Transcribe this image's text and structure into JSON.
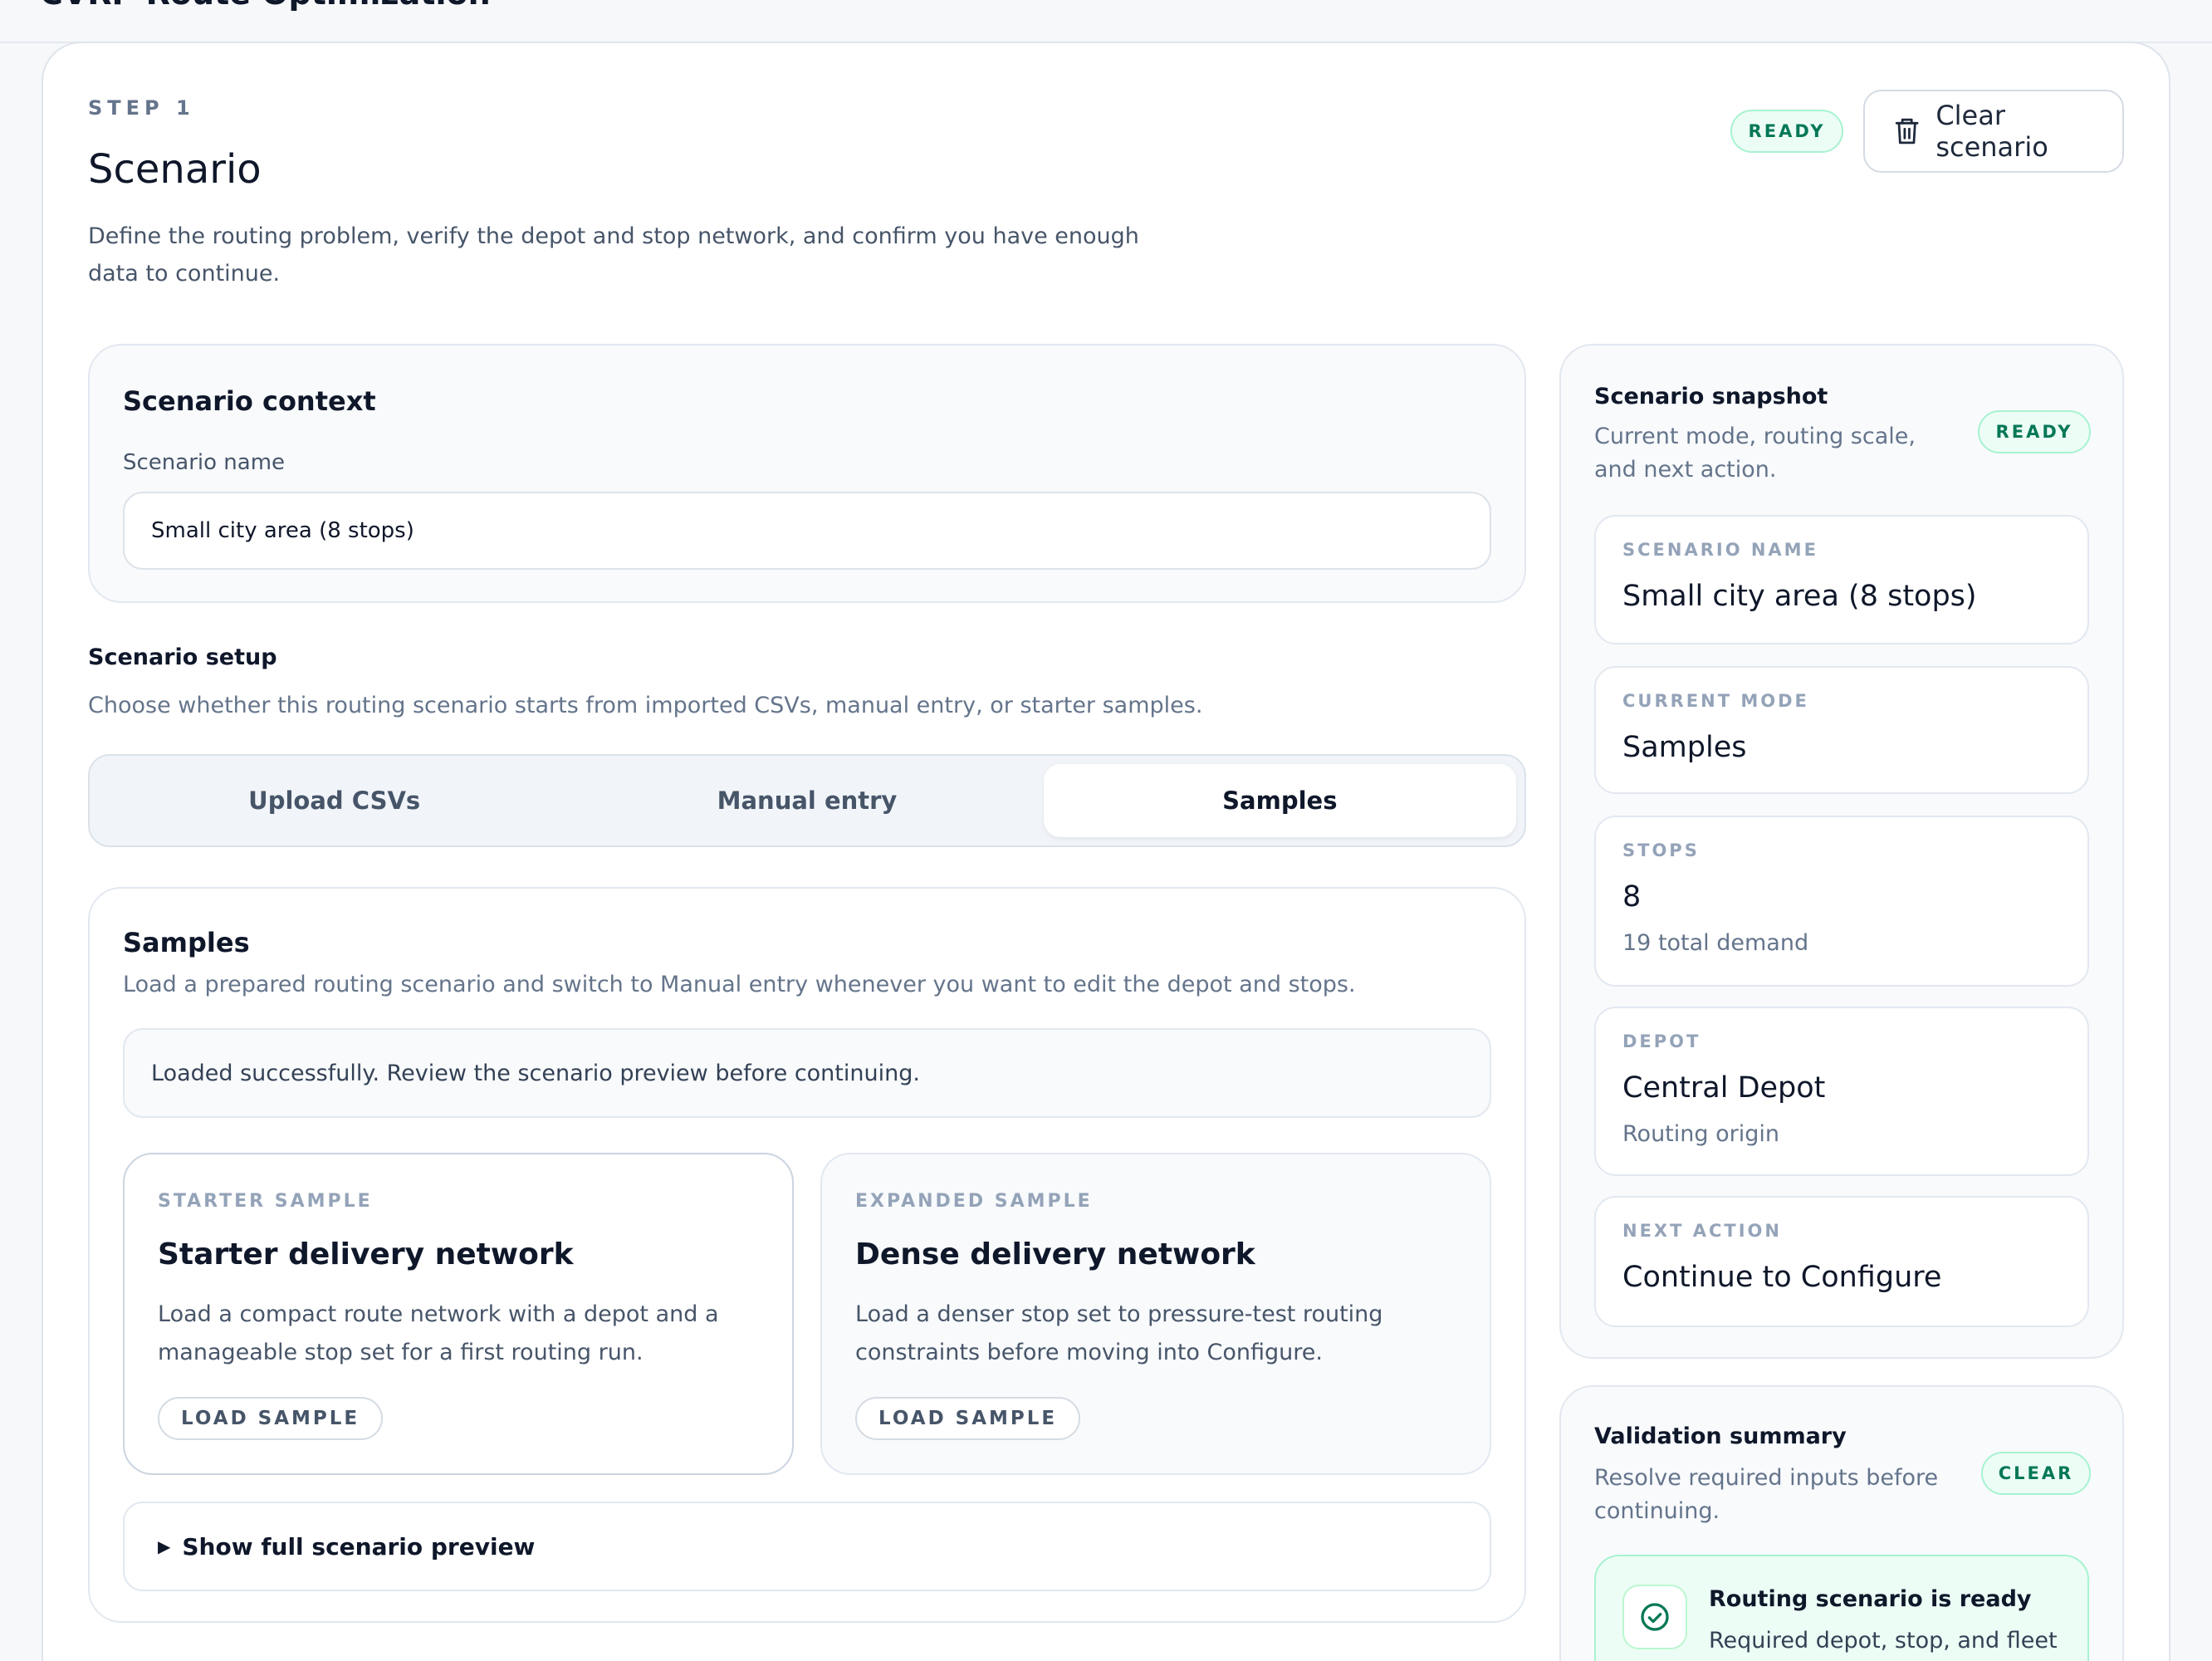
{
  "app": {
    "title": "CVRP Route Optimization"
  },
  "header": {
    "step": "STEP 1",
    "title": "Scenario",
    "description": "Define the routing problem, verify the depot and stop network, and confirm you have enough data to continue.",
    "status_badge": "READY",
    "clear_button": "Clear scenario"
  },
  "context": {
    "title": "Scenario context",
    "name_label": "Scenario name",
    "name_value": "Small city area (8 stops)"
  },
  "setup": {
    "title": "Scenario setup",
    "description": "Choose whether this routing scenario starts from imported CSVs, manual entry, or starter samples.",
    "tabs": [
      {
        "label": "Upload CSVs",
        "active": false
      },
      {
        "label": "Manual entry",
        "active": false
      },
      {
        "label": "Samples",
        "active": true
      }
    ]
  },
  "samples": {
    "title": "Samples",
    "description": "Load a prepared routing scenario and switch to Manual entry whenever you want to edit the depot and stops.",
    "notice": "Loaded successfully. Review the scenario preview before continuing.",
    "cards": [
      {
        "kicker": "STARTER SAMPLE",
        "name": "Starter delivery network",
        "description": "Load a compact route network with a depot and a manageable stop set for a first routing run.",
        "button": "LOAD SAMPLE"
      },
      {
        "kicker": "EXPANDED SAMPLE",
        "name": "Dense delivery network",
        "description": "Load a denser stop set to pressure-test routing constraints before moving into Configure.",
        "button": "LOAD SAMPLE"
      }
    ],
    "preview_toggle": "Show full scenario preview"
  },
  "snapshot": {
    "title": "Scenario snapshot",
    "description": "Current mode, routing scale, and next action.",
    "badge": "READY",
    "items": [
      {
        "kicker": "SCENARIO NAME",
        "value": "Small city area (8 stops)",
        "sub": ""
      },
      {
        "kicker": "CURRENT MODE",
        "value": "Samples",
        "sub": ""
      },
      {
        "kicker": "STOPS",
        "value": "8",
        "sub": "19 total demand"
      },
      {
        "kicker": "DEPOT",
        "value": "Central Depot",
        "sub": "Routing origin"
      },
      {
        "kicker": "NEXT ACTION",
        "value": "Continue to Configure",
        "sub": ""
      }
    ]
  },
  "validation": {
    "title": "Validation summary",
    "description": "Resolve required inputs before continuing.",
    "badge": "CLEAR",
    "ready_title": "Routing scenario is ready",
    "ready_desc": "Required depot, stop, and fleet"
  },
  "colors": {
    "accent_green": "#047857",
    "badge_bg": "#ecfdf5",
    "badge_border": "#a7f3d0"
  },
  "icons": {
    "clear": "trash-icon",
    "ready": "check-circle-icon",
    "preview": "triangle-right-icon"
  }
}
